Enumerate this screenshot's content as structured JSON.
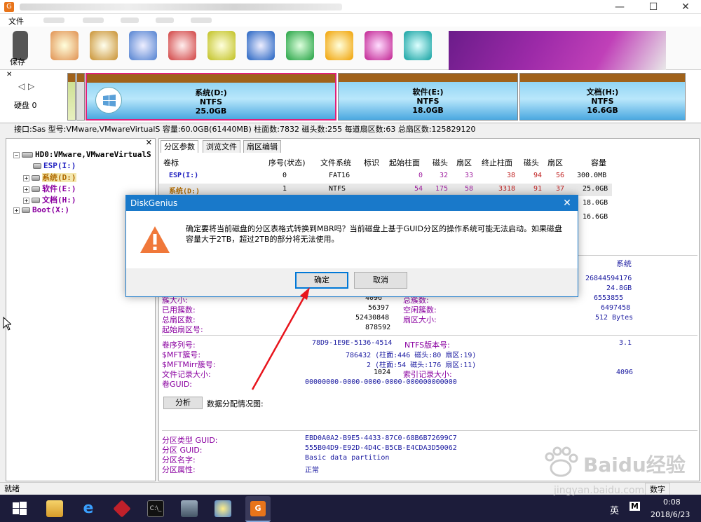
{
  "window": {
    "title_blurred": true,
    "menu_file": "文件",
    "close": "✕",
    "maximize": "☐",
    "minimize": "—"
  },
  "toolbar": {
    "save_label": "保存"
  },
  "diskmap": {
    "disk_label": "硬盘 0",
    "partitions": [
      {
        "name": "系统(D:)",
        "fs": "NTFS",
        "size": "25.0GB"
      },
      {
        "name": "软件(E:)",
        "fs": "NTFS",
        "size": "18.0GB"
      },
      {
        "name": "文档(H:)",
        "fs": "NTFS",
        "size": "16.6GB"
      }
    ]
  },
  "infoline": "接口:Sas  型号:VMware,VMwareVirtualS  容量:60.0GB(61440MB)  柱面数:7832  磁头数:255  每道扇区数:63  总扇区数:125829120",
  "tree": {
    "disk": "HD0:VMware,VMwareVirtualS",
    "items": [
      "ESP(I:)",
      "系统(D:)",
      "软件(E:)",
      "文档(H:)",
      "Boot(X:)"
    ]
  },
  "tabs": [
    "分区参数",
    "浏览文件",
    "扇区编辑"
  ],
  "table": {
    "headers": [
      "卷标",
      "序号(状态)",
      "文件系统",
      "标识",
      "起始柱面",
      "磁头",
      "扇区",
      "终止柱面",
      "磁头",
      "扇区",
      "容量"
    ],
    "rows": [
      [
        "ESP(I:)",
        "0",
        "FAT16",
        "",
        "0",
        "32",
        "33",
        "38",
        "94",
        "56",
        "300.0MB"
      ],
      [
        "系统(D:)",
        "1",
        "NTFS",
        "",
        "54",
        "175",
        "58",
        "3318",
        "91",
        "37",
        "25.0GB"
      ],
      [
        "",
        "",
        "",
        "",
        "",
        "",
        "",
        "",
        "",
        "",
        "18.0GB"
      ],
      [
        "",
        "",
        "",
        "",
        "",
        "",
        "",
        "",
        "",
        "",
        "16.6GB"
      ]
    ]
  },
  "details": {
    "right_title": "系统",
    "right_vals": [
      "26844594176",
      "24.8GB",
      "6553855",
      "6497458",
      "512 Bytes"
    ],
    "cluster_rows": [
      {
        "label": "簇大小:",
        "value": "4096",
        "label2": "总簇数:"
      },
      {
        "label": "已用簇数:",
        "value": "56397",
        "label2": "空闲簇数:"
      },
      {
        "label": "总扇区数:",
        "value": "52430848",
        "label2": "扇区大小:"
      },
      {
        "label": "起始扇区号:",
        "value": "878592",
        "label2": ""
      }
    ],
    "ntfs": {
      "serial_label": "卷序列号:",
      "serial": "78D9-1E9E-5136-4514",
      "ver_label": "NTFS版本号:",
      "ver": "3.1",
      "mft_label": "$MFT簇号:",
      "mft": "786432 (柱面:446 磁头:80 扇区:19)",
      "mftmirr_label": "$MFTMirr簇号:",
      "mftmirr": "2 (柱面:54 磁头:176 扇区:11)",
      "rec_label": "文件记录大小:",
      "rec": "1024",
      "idx_label": "索引记录大小:",
      "idx": "4096",
      "guid_label": "卷GUID:",
      "guid": "00000000-0000-0000-0000-000000000000"
    },
    "analyze_button": "分析",
    "analyze_label": "数据分配情况图:",
    "guids": [
      {
        "label": "分区类型 GUID:",
        "value": "EBD0A0A2-B9E5-4433-87C0-68B6B72699C7"
      },
      {
        "label": "分区 GUID:",
        "value": "555B04D9-E92D-4D4C-B5CB-E4CDA3D50062"
      },
      {
        "label": "分区名字:",
        "value": "Basic data partition"
      },
      {
        "label": "分区属性:",
        "value": "正常"
      }
    ]
  },
  "status": {
    "left": "就绪",
    "right": "数字"
  },
  "taskbar": {
    "time": "0:08",
    "date": "2018/6/23",
    "ime": "英",
    "ime2": "M"
  },
  "dialog": {
    "title": "DiskGenius",
    "message": "确定要将当前磁盘的分区表格式转换到MBR吗？当前磁盘上基于GUID分区的操作系统可能无法启动。如果磁盘容量大于2TB，超过2TB的部分将无法使用。",
    "ok": "确定",
    "cancel": "取消"
  },
  "watermark": {
    "brand": "Baidu经验",
    "url": "jingyan.baidu.com"
  },
  "colors": {
    "dialog_title": "#1979ca",
    "label_purple": "#8a00a0",
    "value_blue": "#1a1aa0",
    "taskbar": "#1c1c3a"
  }
}
